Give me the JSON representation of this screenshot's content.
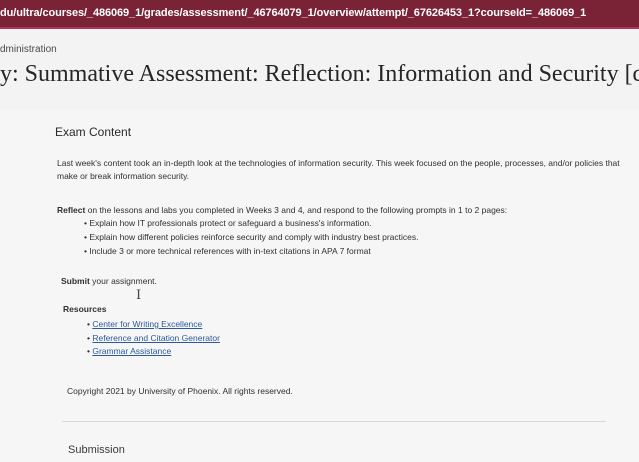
{
  "browser": {
    "url": "du/ultra/courses/_486069_1/grades/assessment/_46764079_1/overview/attempt/_67626453_1?courseId=_486069_1"
  },
  "breadcrumb": "dministration",
  "page_title": "y: Summative Assessment: Reflection: Information and Security [du",
  "exam_content": {
    "heading": "Exam Content",
    "intro": "Last week's content took an in-depth look at the technologies of information security. This week focused on the people, processes, and/or policies that make or break information security.",
    "reflect_bold": "Reflect",
    "reflect_rest": " on the lessons and labs you completed in Weeks 3 and 4, and respond to the following prompts in 1 to 2 pages:",
    "prompts": [
      "Explain how IT professionals protect or safeguard a business's information.",
      "Explain how different policies reinforce security and comply with industry best practices.",
      "Include 3 or more technical references with in-text citations in APA 7 format"
    ],
    "submit_bold": "Submit",
    "submit_rest": " your assignment.",
    "cursor_glyph": "I",
    "resources_title": "Resources",
    "resources": [
      "Center for Writing Excellence",
      "Reference and Citation Generator",
      "Grammar Assistance"
    ],
    "copyright": "Copyright 2021 by University of Phoenix. All rights reserved."
  },
  "submission_heading": "Submission"
}
